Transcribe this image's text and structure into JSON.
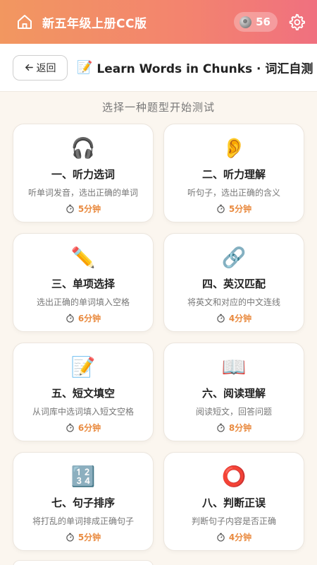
{
  "topbar": {
    "title": "新五年级上册CC版",
    "coins": "56",
    "home_icon": "home-icon",
    "gear_icon": "gear-icon"
  },
  "header": {
    "back_label": "返回",
    "title_emoji": "📝",
    "title": "Learn Words in Chunks · 词汇自测"
  },
  "subtitle": "选择一种题型开始测试",
  "cards": [
    {
      "icon": "🎧",
      "title": "一、听力选词",
      "desc": "听单词发音，选出正确的单词",
      "time": "5分钟"
    },
    {
      "icon": "👂",
      "title": "二、听力理解",
      "desc": "听句子，选出正确的含义",
      "time": "5分钟"
    },
    {
      "icon": "✏️",
      "title": "三、单项选择",
      "desc": "选出正确的单词填入空格",
      "time": "6分钟"
    },
    {
      "icon": "🔗",
      "title": "四、英汉匹配",
      "desc": "将英文和对应的中文连线",
      "time": "4分钟"
    },
    {
      "icon": "📝",
      "title": "五、短文填空",
      "desc": "从词库中选词填入短文空格",
      "time": "6分钟"
    },
    {
      "icon": "📖",
      "title": "六、阅读理解",
      "desc": "阅读短文，回答问题",
      "time": "8分钟"
    },
    {
      "icon": "🔢",
      "title": "七、句子排序",
      "desc": "将打乱的单词排成正确句子",
      "time": "5分钟"
    },
    {
      "icon": "⭕",
      "title": "八、判断正误",
      "desc": "判断句子内容是否正确",
      "time": "4分钟"
    }
  ],
  "colors": {
    "accent_start": "#f29760",
    "accent_end": "#f0707f",
    "time_color": "#e98a3f",
    "background": "#fbf6ef"
  }
}
